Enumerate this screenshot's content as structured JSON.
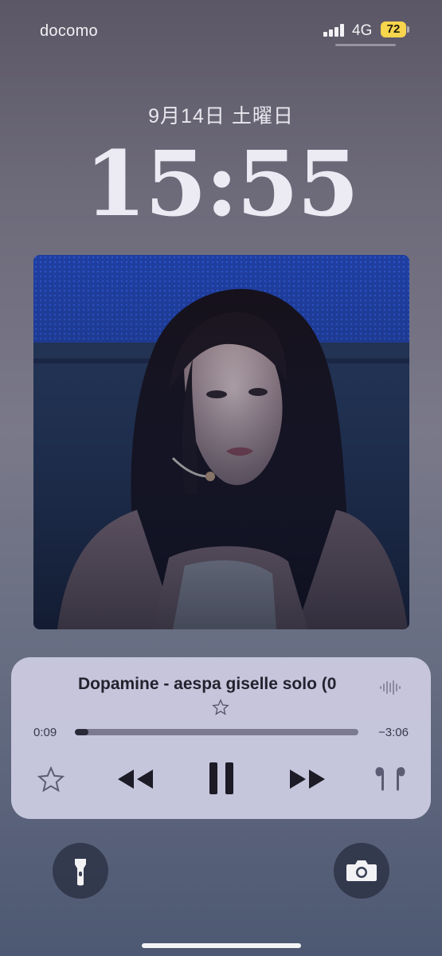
{
  "status_bar": {
    "carrier": "docomo",
    "network": "4G",
    "battery": "72",
    "battery_color": "#f7d54c"
  },
  "lock": {
    "date": "9月14日 土曜日",
    "time": "15:55"
  },
  "artwork": {
    "icon": "album-artwork-photo"
  },
  "now_playing": {
    "title": "Dopamine - aespa giselle solo (0",
    "elapsed": "0:09",
    "remaining": "−3:06",
    "progress": 0.047
  },
  "icons": {
    "favorite": "star-icon",
    "rewind": "rewind-icon",
    "pause": "pause-icon",
    "fast_forward": "fast-forward-icon",
    "output": "airpods-icon",
    "flashlight": "flashlight-icon",
    "camera": "camera-icon"
  }
}
